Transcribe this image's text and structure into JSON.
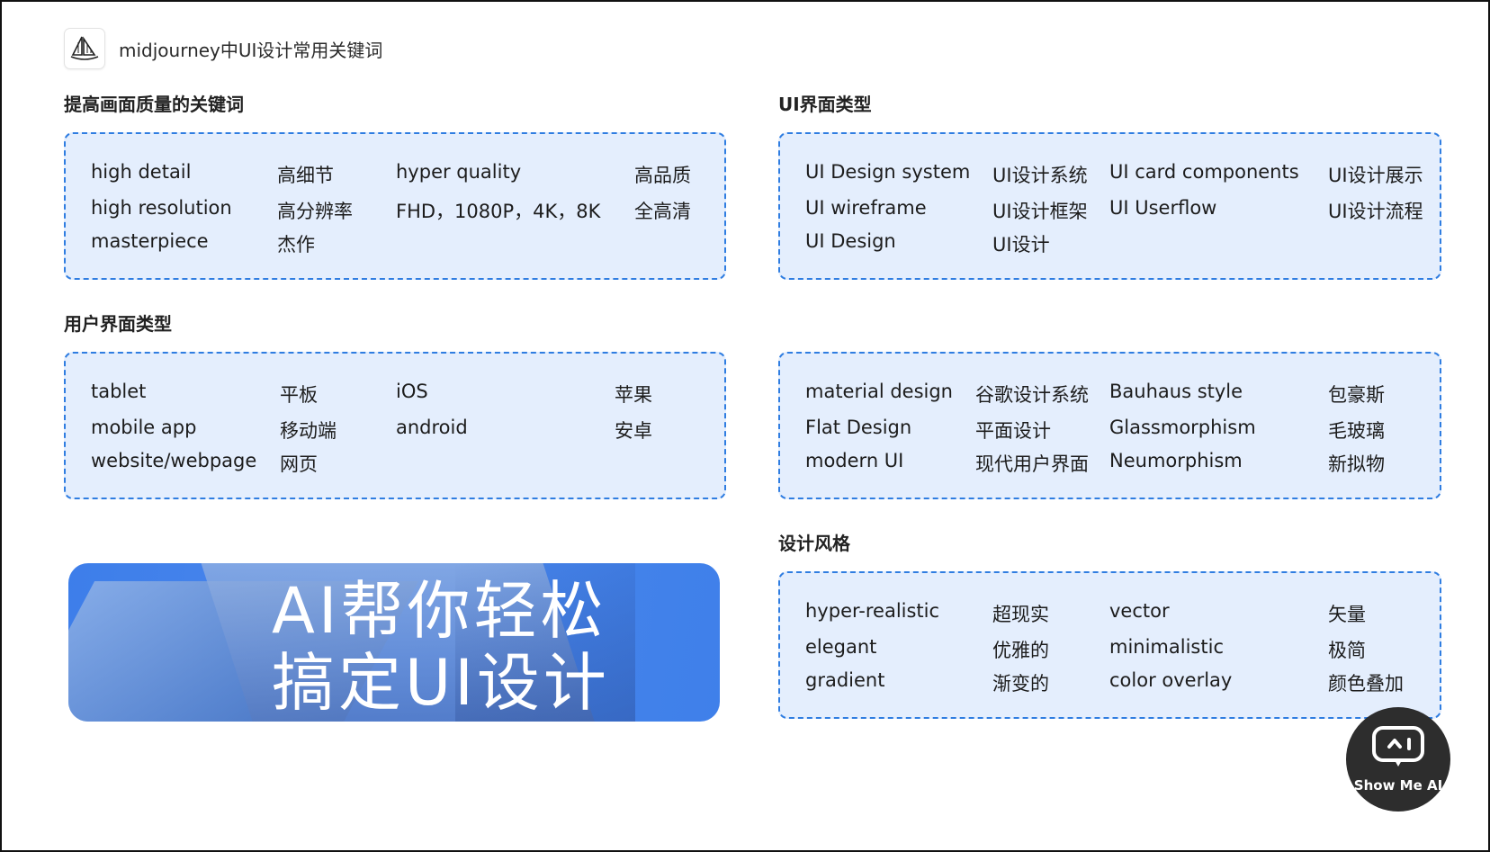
{
  "header": {
    "title": "midjourney中UI设计常用关键词",
    "logo_icon": "sailboat-icon"
  },
  "sections": {
    "quality": {
      "title": "提高画面质量的关键词",
      "rows": [
        [
          "high detail",
          "高细节",
          "hyper quality",
          "高品质"
        ],
        [
          "high resolution",
          "高分辨率",
          "FHD，1080P，4K，8K",
          "全高清"
        ],
        [
          "masterpiece",
          "杰作",
          "",
          ""
        ]
      ]
    },
    "ui_types": {
      "title": "UI界面类型",
      "rows": [
        [
          "UI Design system",
          "UI设计系统",
          "UI card components",
          "UI设计展示"
        ],
        [
          "UI wireframe",
          "UI设计框架",
          "UI Userflow",
          "UI设计流程"
        ],
        [
          "UI Design",
          "UI设计",
          "",
          ""
        ]
      ]
    },
    "user_interface": {
      "title": "用户界面类型",
      "rows": [
        [
          "tablet",
          "平板",
          "iOS",
          "苹果"
        ],
        [
          "mobile app",
          "移动端",
          "android",
          "安卓"
        ],
        [
          "website/webpage",
          "网页",
          "",
          ""
        ]
      ]
    },
    "styles_a": {
      "title": "",
      "rows": [
        [
          "material design",
          "谷歌设计系统",
          "Bauhaus style",
          "包豪斯"
        ],
        [
          "Flat Design",
          "平面设计",
          "Glassmorphism",
          "毛玻璃"
        ],
        [
          "modern UI",
          "现代用户界面",
          "Neumorphism",
          "新拟物"
        ]
      ]
    },
    "design_style": {
      "title": "设计风格",
      "rows": [
        [
          "hyper-realistic",
          "超现实",
          "vector",
          "矢量"
        ],
        [
          "elegant",
          "优雅的",
          "minimalistic",
          "极简"
        ],
        [
          "gradient",
          "渐变的",
          "color overlay",
          "颜色叠加"
        ]
      ]
    }
  },
  "banner": {
    "line1": "AI帮你轻松",
    "line2": "搞定UI设计"
  },
  "watermark": {
    "label": "Show Me AI",
    "icon": "robot-monitor-icon"
  },
  "colors": {
    "card_bg": "#e4eefd",
    "card_border": "#2f7de1",
    "banner_bg": "#3d7eea"
  }
}
